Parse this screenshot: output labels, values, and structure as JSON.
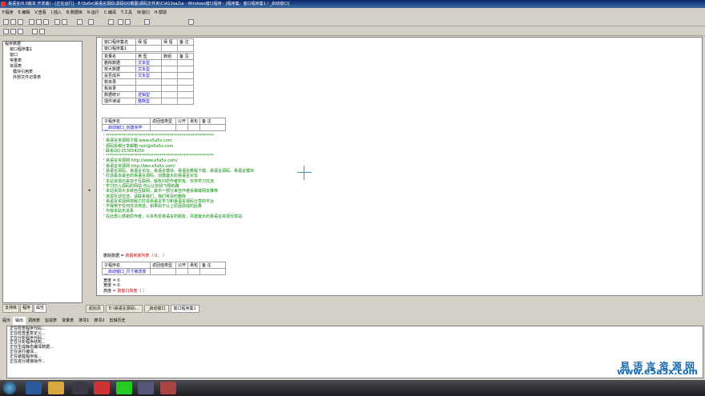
{
  "window": {
    "title": "易语言(6.0版本 开发版) - [正在运行] - E:\\5a5x\\易语言源码\\源码QQ截图\\源码文件夹\\C\\A12sa2\\a - Windows窗口程序 - [程序集：窗口程序集1 / _启动窗口]"
  },
  "menu": [
    "F.程序",
    "E.编辑",
    "V.查看",
    "I.插入",
    "B.数据库",
    "R.运行",
    "C.编译",
    "T.工具",
    "W.窗口",
    "H.帮助"
  ],
  "tree": {
    "items": [
      "程序数据",
      "窗口程序集1",
      "窗口",
      "常量表",
      "资源表",
      "模块引用表",
      "外部文件记录表"
    ]
  },
  "left_tabs": [
    "支持库",
    "程序",
    "属性"
  ],
  "editor": {
    "assembly_table": {
      "headers": [
        "窗口程序集名",
        "保 留",
        "保 留",
        "备 注"
      ],
      "name": "窗口程序集1"
    },
    "var_headers": [
      "变量名",
      "类 型",
      "数组",
      "备 注"
    ],
    "vars": [
      [
        "删除数据",
        "文本型"
      ],
      [
        "校大数据",
        "文本型"
      ],
      [
        "是否成并",
        "文本型"
      ],
      [
        "枚目录",
        ""
      ],
      [
        "枚目录",
        ""
      ],
      [
        "数据统计",
        "逻辑型"
      ],
      [
        "插件读减",
        "整数型"
      ]
    ],
    "sub1": {
      "headers": [
        "子程序名",
        "返回值类型",
        "公开",
        "易包",
        "备 注"
      ],
      "name": "__启动窗口_创建完毕"
    },
    "comments": [
      "' ******************************************************",
      "' 易语言资源网下载     www.e5a5x.com",
      "' 源码投稿分享邮箱   root@e5a5x.com",
      "' 联系QQ    253654250",
      "' ******************************************************",
      "' 易语言资源网 http://www.e5a5x.com/",
      "' 易语言资源网 http://bbs.e5a5x.com/",
      "' 易语言源码、易语言论坛、易语言模块、易语言教程下载、易语言源码、易语言模块",
      "' 打造最多最全的易语言源码，创建最大的易语言论坛",
      "' 本站资源均来自于互联网，版权归原作者所有，仅供学习交流",
      "' 学习仍入源码的网站 可以让你找飞翔的路",
      "' 本站资源大多转自互联网，其中一部分来自作者投稿或网友推荐",
      "' 资源互动交流，请联系我们，我们将及时删除",
      "' 易语言资源网将致力打造易语言学习和易语言源码分享的平台",
      "' 不得用于任何非法用途，如果由于以上原因造成的后果",
      "' 与我本站无关系",
      "' 在此衷心感谢原作者，众多热爱易语言的朋友，共建最大的易语言资源分享站"
    ],
    "stmt1": {
      "target": "删除数据",
      "op": " = ",
      "value": "真假到底列表（ 0， ）"
    },
    "sub2": {
      "headers": [
        "子程序名",
        "返回值类型",
        "公开",
        "易包",
        "备 注"
      ],
      "name": "__启动窗口_尺寸被改变"
    },
    "stmts": [
      [
        "宽度",
        " = 0"
      ],
      [
        "宽度",
        " = 0"
      ],
      [
        "高度",
        " = 取窗口高度（ ）"
      ]
    ]
  },
  "editor_tabs": [
    "起始页",
    "E:\\易语言源码\\...",
    "_启动窗口",
    "窗口程序集1"
  ],
  "output_tabs": [
    "提示",
    "输出",
    "调用表",
    "监视表",
    "变量表",
    "搜寻1",
    "搜寻2",
    "剪辑历史"
  ],
  "output_lines": [
    "正在检查程序代码...",
    "正在检查重复定义...",
    "正在分析程序代码...",
    "正在分析程序结构...",
    "正在生成静态编译数据...",
    "正在进行编译...",
    "正在装载程序库...",
    "正在进行链接操作..."
  ],
  "watermark": {
    "cn": "易 语 言 资 源 网",
    "url": "www.e5a5x.com"
  }
}
